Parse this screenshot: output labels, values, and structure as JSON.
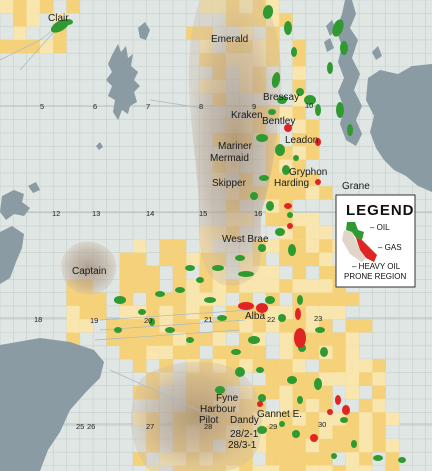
{
  "colors": {
    "sea": "#dfe6e3",
    "land": "#8a9aa3",
    "licence": "#f5d27a",
    "licence_light": "#f9e6ae",
    "oil": "#2f9a2f",
    "gas": "#e02424",
    "heavy_oil": "#b49a86",
    "grid": "#c9d3d0"
  },
  "fields": {
    "clair": "Clair",
    "emerald": "Emerald",
    "bressay": "Bressay",
    "kraken": "Kraken",
    "bentley": "Bentley",
    "leadon": "Leadon",
    "mariner": "Mariner",
    "mermaid": "Mermaid",
    "gryphon": "Gryphon",
    "harding": "Harding",
    "skipper": "Skipper",
    "grane": "Grane",
    "west_brae": "West Brae",
    "captain": "Captain",
    "alba": "Alba",
    "fyne": "Fyne",
    "harbour": "Harbour",
    "pilot": "Pilot",
    "dandy": "Dandy",
    "gannet_e": "Gannet E.",
    "block_28_2_1": "28/2-1",
    "block_28_3_1": "28/3-1"
  },
  "quadrants": {
    "q5": "5",
    "q6": "6",
    "q7": "7",
    "q8": "8",
    "q9": "9",
    "q10": "10",
    "q12": "12",
    "q13": "13",
    "q14": "14",
    "q15": "15",
    "q16": "16",
    "q18": "18",
    "q19": "19",
    "q20": "20",
    "q21": "21",
    "q22": "22",
    "q23": "23",
    "q25": "25",
    "q26": "26",
    "q27": "27",
    "q28": "28",
    "q29": "29",
    "q30": "30"
  },
  "legend": {
    "title": "LEGEND",
    "oil": "– OIL",
    "gas": "– GAS",
    "heavy_oil_line1": "– HEAVY OIL",
    "heavy_oil_line2": "PRONE REGION"
  }
}
